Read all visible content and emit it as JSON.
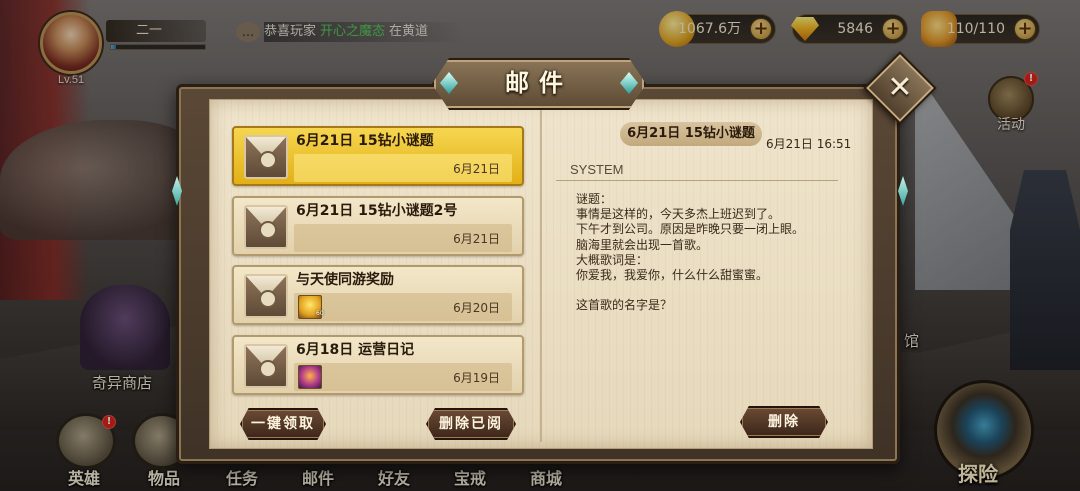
{
  "player": {
    "name": "二一",
    "level": "Lv.51",
    "exp_fraction": 0.05
  },
  "ticker": {
    "prefix": "恭喜玩家",
    "highlight": "开心之魔态",
    "suffix": "在黄道"
  },
  "resources": {
    "gold": "1067.6万",
    "gems": "5846",
    "stamina": "110/110"
  },
  "activity": {
    "label": "活动",
    "badge": "!"
  },
  "side_labels": {
    "shop": "奇异商店",
    "hall": "馆"
  },
  "bottom_nav": [
    "英雄",
    "物品",
    "任务",
    "邮件",
    "好友",
    "宝戒",
    "商城"
  ],
  "explore_label": "探险",
  "hero_badge": "!",
  "mail_window": {
    "title": "邮件",
    "close_label": "✕",
    "mails": [
      {
        "subject": "6月21日 15钻小谜题",
        "date": "6月21日",
        "selected": true,
        "attachment": ""
      },
      {
        "subject": "6月21日 15钻小谜题2号",
        "date": "6月21日",
        "selected": false,
        "attachment": ""
      },
      {
        "subject": "与天使同游奖励",
        "date": "6月20日",
        "selected": false,
        "attachment": "gem",
        "attachment_count": "60"
      },
      {
        "subject": "6月18日 运营日记",
        "date": "6月19日",
        "selected": false,
        "attachment": "item"
      }
    ],
    "claim_all_label": "一键领取",
    "delete_read_label": "删除已阅",
    "detail": {
      "title": "6月21日 15钻小谜题",
      "time": "6月21日 16:51",
      "sender": "SYSTEM",
      "body": [
        "谜题：",
        "事情是这样的，今天多杰上班迟到了。",
        "下午才到公司。原因是昨晚只要一闭上眼。",
        "脑海里就会出现一首歌。",
        "大概歌词是：",
        "你爱我，我爱你，什么什么甜蜜蜜。",
        "",
        "这首歌的名字是？"
      ],
      "delete_label": "删除"
    }
  }
}
